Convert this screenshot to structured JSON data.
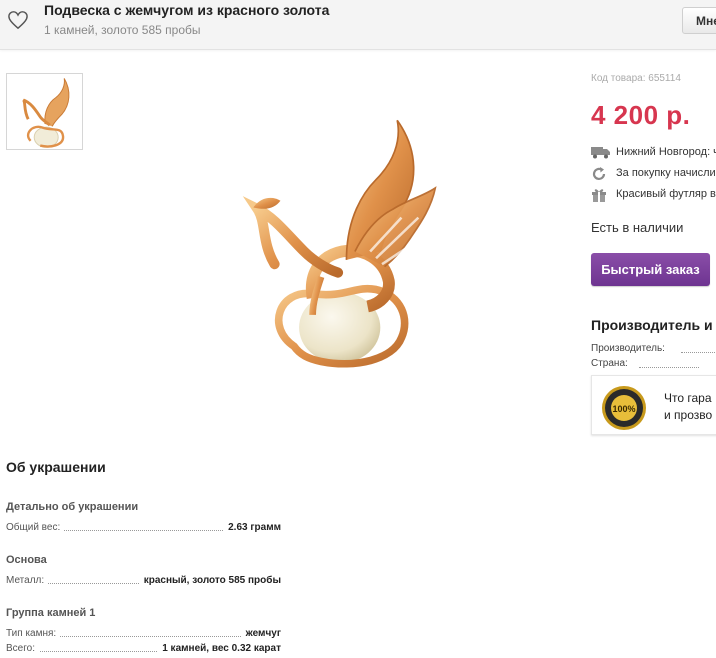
{
  "header": {
    "title": "Подвеска с жемчугом из красного золота",
    "subtitle": "1 камней, золото 585 пробы",
    "opinion_button": "Мнение"
  },
  "product": {
    "sku": "Код товара: 655114",
    "price": "4 200 р.",
    "delivery": "Нижний Новгород: ч",
    "bonus": "За покупку начисли",
    "gift": "Красивый футляр в",
    "stock": "Есть в наличии",
    "quick_order": "Быстрый заказ"
  },
  "maker": {
    "heading": "Производитель и",
    "producer_label": "Производитель:",
    "country_label": "Страна:",
    "guarantee_line1": "Что гара",
    "guarantee_line2": "и прозво",
    "badge_text": "100%"
  },
  "about": {
    "heading": "Об украшении",
    "groups": [
      {
        "title": "Детально об украшении",
        "props": [
          {
            "key": "Общий вес:",
            "value": "2.63 грамм"
          }
        ]
      },
      {
        "title": "Основа",
        "props": [
          {
            "key": "Металл:",
            "value": "красный, золото 585 пробы"
          }
        ]
      },
      {
        "title": "Группа камней 1",
        "props": [
          {
            "key": "Тип камня:",
            "value": "жемчуг"
          },
          {
            "key": "Всего:",
            "value": "1 камней, вес 0.32 карат"
          }
        ]
      }
    ]
  },
  "colors": {
    "price": "#d7364f",
    "quick_order_bg": "#7a3e9b",
    "gold": "#e0914a",
    "pearl": "#f1ecd8"
  },
  "icons": [
    "heart-icon",
    "truck-icon",
    "refresh-icon",
    "gift-icon",
    "guarantee-badge-icon"
  ]
}
